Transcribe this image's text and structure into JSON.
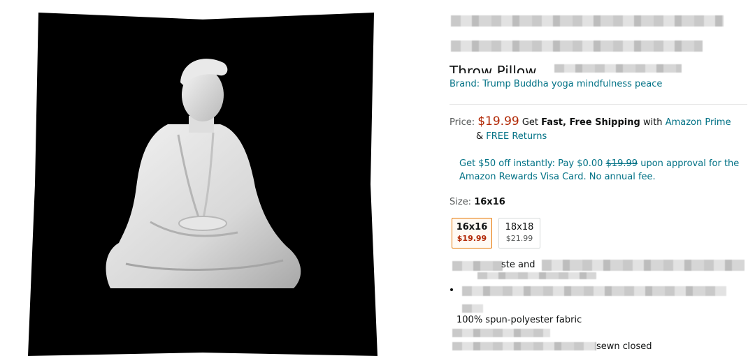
{
  "product": {
    "title_visible": "Throw Pillow,",
    "brand": "Brand: Trump Buddha yoga mindfulness peace"
  },
  "pricing": {
    "label": "Price:",
    "price": "$19.99",
    "shipping_prefix": "Get",
    "shipping_bold": "Fast, Free Shipping",
    "shipping_with": "with",
    "prime_link": "Amazon Prime",
    "returns_prefix": "&",
    "returns_link": "FREE Returns"
  },
  "promo": {
    "text1": "Get $50 off instantly: Pay $0.00",
    "strike_price": "$19.99",
    "text2": "upon approval for the Amazon Rewards Visa Card. No annual fee."
  },
  "size": {
    "label": "Size:",
    "selected": "16x16",
    "options": [
      {
        "size": "16x16",
        "price": "$19.99"
      },
      {
        "size": "18x18",
        "price": "$21.99"
      }
    ]
  },
  "fragments": {
    "f1": "ste and",
    "f2": "100% spun-polyester fabric",
    "f3": "sewn closed"
  }
}
